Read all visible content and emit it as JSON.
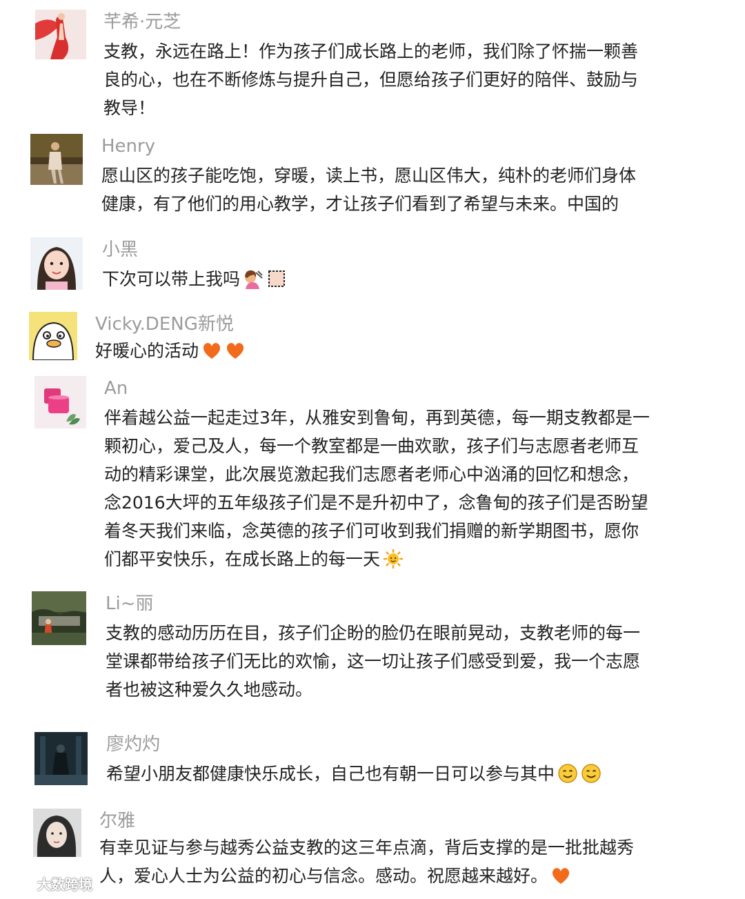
{
  "comments": [
    {
      "name": "芊希·元芝",
      "lines": [
        "支教，永远在路上！作为孩子们成长路上的老师，我们除了怀揣一颗善",
        "良的心，也在不断修炼与提升自己，但愿给孩子们更好的陪伴、鼓励与",
        "教导！"
      ],
      "avatar_icon": "dancer-photo"
    },
    {
      "name": "Henry",
      "lines": [
        "愿山区的孩子能吃饱，穿暖，读上书，愿山区伟大，纯朴的老师们身体",
        "健康，有了他们的用心教学，才让孩子们看到了希望与未来。中国的"
      ],
      "avatar_icon": "outdoor-photo"
    },
    {
      "name": "小黑",
      "lines": [
        "下次可以带上我吗"
      ],
      "avatar_icon": "girl-photo",
      "emojis": [
        "haircut-emoji",
        "placeholder-emoji"
      ]
    },
    {
      "name": "Vicky.DENG新悦",
      "lines": [
        "好暖心的活动"
      ],
      "avatar_icon": "duck-cartoon",
      "emojis": [
        "orange-heart-emoji",
        "orange-heart-emoji"
      ]
    },
    {
      "name": "An",
      "lines": [
        "伴着越公益一起走过3年，从雅安到鲁甸，再到英德，每一期支教都是一",
        "颗初心，爱己及人，每一个教室都是一曲欢歌，孩子们与志愿者老师互",
        "动的精彩课堂，此次展览激起我们志愿者老师心中汹涌的回忆和想念，",
        "念2016大坪的五年级孩子们是不是升初中了，念鲁甸的孩子们是否盼望",
        "着冬天我们来临，念英德的孩子们可收到我们捐赠的新学期图书，愿你",
        "们都平安快乐，在成长路上的每一天"
      ],
      "avatar_icon": "candle-photo",
      "emojis": [
        "sun-emoji"
      ]
    },
    {
      "name": "Li~丽",
      "lines": [
        "支教的感动历历在目，孩子们企盼的脸仍在眼前晃动，支教老师的每一",
        "堂课都带给孩子们无比的欢愉，这一切让孩子们感受到爱，我一个志愿",
        "者也被这种爱久久地感动。"
      ],
      "avatar_icon": "garden-photo"
    },
    {
      "name": "廖灼灼",
      "lines": [
        "希望小朋友都健康快乐成长，自己也有朝一日可以参与其中"
      ],
      "avatar_icon": "dark-scene-photo",
      "emojis": [
        "smile-emoji",
        "smile-emoji"
      ]
    },
    {
      "name": "尔雅",
      "lines": [
        "有幸见证与参与越秀公益支教的这三年点滴，背后支撑的是一批批越秀",
        "人，爱心人士为公益的初心与信念。感动。祝愿越来越好。"
      ],
      "avatar_icon": "woman-portrait",
      "emojis": [
        "orange-heart-emoji"
      ]
    }
  ],
  "watermark": {
    "text": "大数跨境",
    "icon": "weibo-logo-icon"
  },
  "colors": {
    "name": "#9b9b9b",
    "text": "#222222",
    "heart": "#f26b1d"
  }
}
